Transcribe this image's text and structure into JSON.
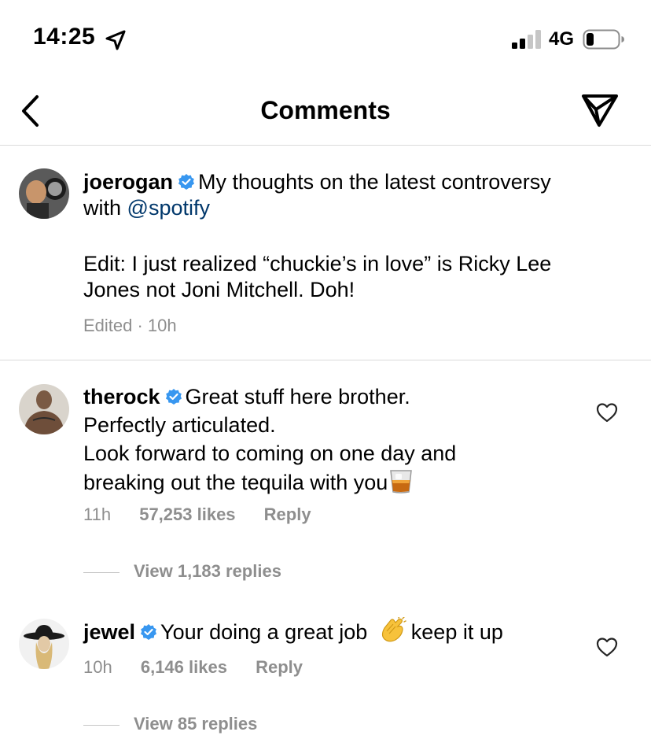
{
  "status_bar": {
    "time": "14:25",
    "network": "4G"
  },
  "nav": {
    "title": "Comments"
  },
  "caption": {
    "username": "joerogan",
    "text_part1": "My thoughts on the latest controversy with",
    "mention": "@spotify",
    "edit_line1": "Edit: I just realized “chuckie’s in love” is Ricky Lee",
    "edit_line2": "Jones not Joni Mitchell.  Doh!",
    "meta": "Edited · 10h"
  },
  "comments": [
    {
      "username": "therock",
      "line1": "Great stuff here brother.",
      "line2": "Perfectly articulated.",
      "line3": "Look forward to coming on one day and",
      "line4": "breaking out the tequila with you",
      "emoji": "tumbler-glass",
      "time": "11h",
      "likes": "57,253 likes",
      "reply": "Reply",
      "view_replies": "View 1,183 replies"
    },
    {
      "username": "jewel",
      "text_before": "Your doing a great job",
      "emoji": "clapping-hands",
      "text_after": "keep it up",
      "time": "10h",
      "likes": "6,146 likes",
      "reply": "Reply",
      "view_replies": "View 85 replies"
    }
  ],
  "colors": {
    "verified": "#3897f0",
    "mention": "#00376b",
    "meta": "#8e8e8e",
    "divider": "#dbdbdb"
  }
}
